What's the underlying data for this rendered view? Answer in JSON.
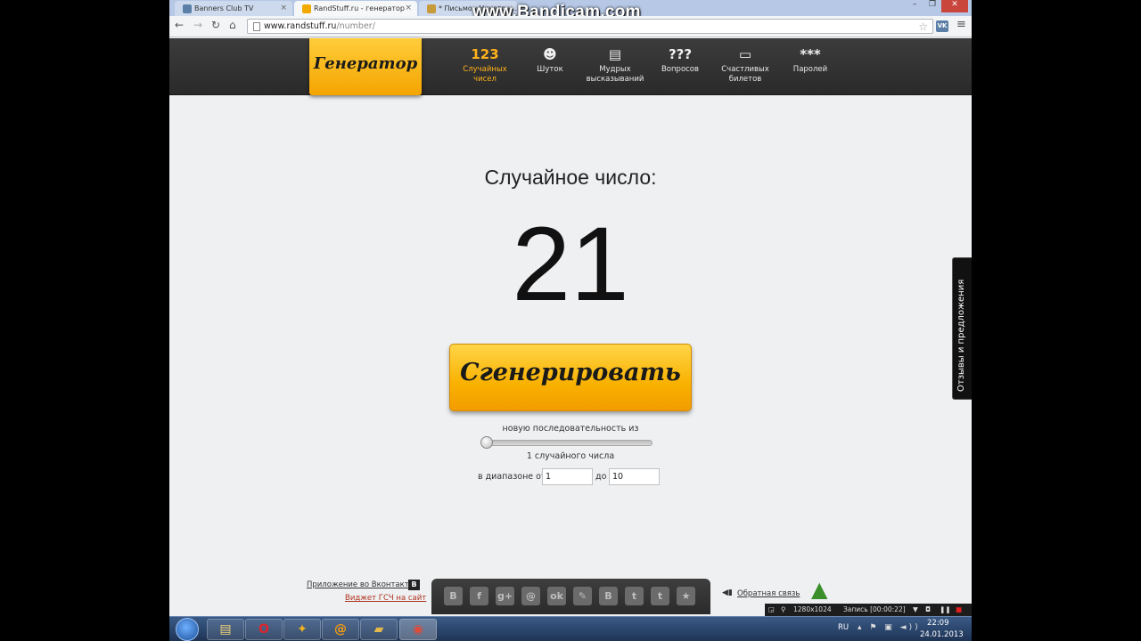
{
  "browser": {
    "tabs": [
      {
        "label": "Banners Club TV",
        "fav_color": "#5b7fa6",
        "fav_glyph": "B"
      },
      {
        "label": "RandStuff.ru - генератор",
        "fav_color": "#f2a900",
        "fav_glyph": ""
      },
      {
        "label": "* Письмо «Ничего н...",
        "fav_color": "#c79a3a",
        "fav_glyph": "Б"
      }
    ],
    "watermark": "www.Bandicam.com",
    "url_host": "www.randstuff.ru",
    "url_path": "/number/",
    "extension_label": "VK"
  },
  "site": {
    "logo": "Генератор",
    "nav": [
      {
        "icon": "123",
        "label_line1": "Случайных",
        "label_line2": "чисел",
        "active": true
      },
      {
        "icon": "☻",
        "label_line1": "Шуток",
        "label_line2": "",
        "active": false
      },
      {
        "icon": "▤",
        "label_line1": "Мудрых",
        "label_line2": "высказываний",
        "active": false
      },
      {
        "icon": "???",
        "label_line1": "Вопросов",
        "label_line2": "",
        "active": false
      },
      {
        "icon": "▭",
        "label_line1": "Счастливых",
        "label_line2": "билетов",
        "active": false
      },
      {
        "icon": "***",
        "label_line1": "Паролей",
        "label_line2": "",
        "active": false
      }
    ]
  },
  "main": {
    "title": "Случайное число:",
    "result": "21",
    "generate_label": "Сгенерировать",
    "sequence_label": "новую последовательность из",
    "sequence_count": 1,
    "count_label": "1 случайного числа",
    "range_from_label": "в диапазоне от",
    "range_from_value": "1",
    "range_to_label": "до",
    "range_to_value": "10"
  },
  "side_tab": "Отзывы и предложения",
  "footer": {
    "vk_app_link": "Приложение во Вконтакте",
    "vk_badge": "B",
    "widget_link": "Виджет ГСЧ на сайт",
    "share_buttons": [
      {
        "name": "vk",
        "glyph": "B"
      },
      {
        "name": "facebook",
        "glyph": "f"
      },
      {
        "name": "google-plus",
        "glyph": "g+"
      },
      {
        "name": "mail",
        "glyph": "@"
      },
      {
        "name": "odnoklassniki",
        "glyph": "ok"
      },
      {
        "name": "livejournal",
        "glyph": "✎"
      },
      {
        "name": "blogger",
        "glyph": "B"
      },
      {
        "name": "twitter",
        "glyph": "t"
      },
      {
        "name": "tumblr",
        "glyph": "t"
      },
      {
        "name": "favorite",
        "glyph": "★"
      }
    ],
    "feedback_link": "Обратная связь"
  },
  "bandicam_strip": {
    "resolution": "1280x1024",
    "recording": "Запись [00:00:22]"
  },
  "taskbar": {
    "apps": [
      {
        "name": "explorer",
        "glyph": "▤",
        "color": "#f3d27a"
      },
      {
        "name": "opera",
        "glyph": "O",
        "color": "#e0242a"
      },
      {
        "name": "game",
        "glyph": "✦",
        "color": "#f1b221"
      },
      {
        "name": "mail-agent",
        "glyph": "@",
        "color": "#f39c12"
      },
      {
        "name": "racing-game",
        "glyph": "▰",
        "color": "#e6b84a"
      },
      {
        "name": "chrome",
        "glyph": "◉",
        "color": "#e04b3a"
      }
    ],
    "language": "RU",
    "time": "22:09",
    "date": "24.01.2013"
  }
}
